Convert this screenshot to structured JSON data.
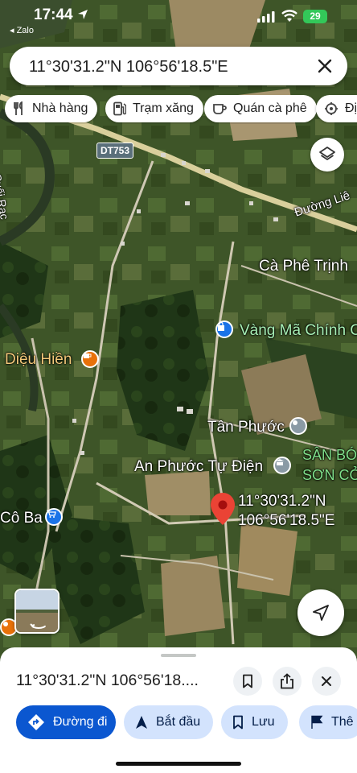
{
  "status_bar": {
    "time": "17:44",
    "back_app": "◂ Zalo",
    "battery": "29"
  },
  "search": {
    "query": "11°30'31.2\"N 106°56'18.5\"E"
  },
  "chips": [
    {
      "label": "Nhà hàng",
      "icon": "restaurant-icon"
    },
    {
      "label": "Trạm xăng",
      "icon": "gas-station-icon"
    },
    {
      "label": "Quán cà phê",
      "icon": "coffee-icon"
    },
    {
      "label": "Địa",
      "icon": "attraction-icon"
    }
  ],
  "map": {
    "road_shield": "DT753",
    "labels": {
      "duong_lien": "Đường Liê",
      "suoi_rac": "Suối Rạc",
      "ca_phe_trinh": "Cà Phê Trịnh",
      "vang_ma": "Vàng Mã Chính C",
      "dieu_hien": "Diệu Hiền",
      "tan_phuoc": "Tân Phước",
      "an_phuoc": "An Phước Tự Điện",
      "san_bong_1": "SÂN BÓ",
      "san_bong_2": "SƠN CỎ",
      "co_ba": "Cô Ba",
      "pin_line1": "11°30'31.2\"N",
      "pin_line2": "106°56'18.5\"E"
    },
    "colors": {
      "pin": "#ea4335",
      "poi_orange": "#e8710a",
      "poi_blue": "#1a73e8",
      "poi_gray": "#8a9aa5"
    }
  },
  "sheet": {
    "title": "11°30'31.2\"N 106°56'18....",
    "actions": [
      {
        "label": "Đường đi",
        "icon": "directions-icon"
      },
      {
        "label": "Bắt đầu",
        "icon": "navigation-arrow-icon"
      },
      {
        "label": "Lưu",
        "icon": "bookmark-icon"
      },
      {
        "label": "Thê",
        "icon": "flag-icon"
      }
    ]
  }
}
